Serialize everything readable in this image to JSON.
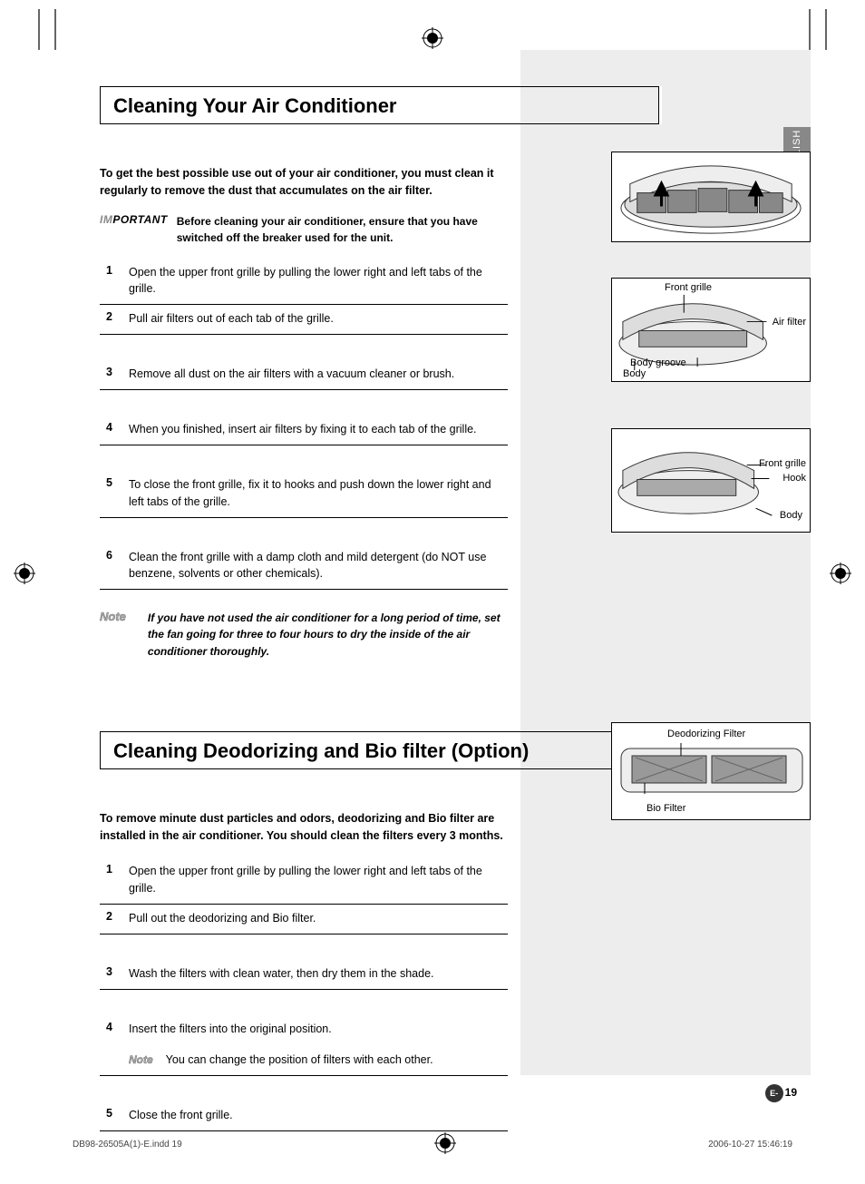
{
  "lang_tab": "ENGLISH",
  "section1": {
    "title": "Cleaning Your Air Conditioner",
    "intro": "To get the best possible use out of your air conditioner, you must clean it regularly to remove the dust that accumulates on the air filter.",
    "important_label_prefix": "IM",
    "important_label_suffix": "PORTANT",
    "important_text": "Before cleaning your air conditioner, ensure that you have switched off the breaker used for the unit.",
    "steps": [
      "Open the upper front grille by pulling the lower right and left tabs of the grille.",
      "Pull air filters out of each tab of the grille.",
      "Remove all dust on the air filters with a vacuum cleaner or brush.",
      "When you finished, insert air filters by fixing it to each tab of the grille.",
      "To close the front grille, fix it to hooks and push down the lower right and left tabs of the grille.",
      "Clean the front grille with a damp cloth and mild detergent (do NOT use benzene, solvents or other chemicals)."
    ],
    "note_label": "Note",
    "note_text": "If you have not used the air conditioner for a long period of time, set the fan going for three to four hours to dry the inside of the air conditioner thoroughly."
  },
  "section2": {
    "title": "Cleaning Deodorizing and Bio filter (Option)",
    "intro": "To remove minute dust particles and odors, deodorizing and Bio filter are installed in the air conditioner. You should clean the filters every 3 months.",
    "steps": [
      "Open the upper front grille by pulling the lower right and left tabs of the grille.",
      "Pull out the deodorizing and Bio filter.",
      "Wash the filters with clean water, then dry them in the shade.",
      "Insert the filters into the original position.",
      "Close the front grille."
    ],
    "inline_note_label": "Note",
    "inline_note_text": "You can change the position of filters with each other."
  },
  "diagram2_labels": {
    "front_grille": "Front grille",
    "air_filter": "Air filter",
    "body_groove": "Body groove",
    "body": "Body"
  },
  "diagram3_labels": {
    "front_grille": "Front grille",
    "hook": "Hook",
    "body": "Body"
  },
  "diagram4_labels": {
    "deodorizing": "Deodorizing Filter",
    "bio": "Bio Filter"
  },
  "page_num_prefix": "E-",
  "page_num": "19",
  "footer_left": "DB98-26505A(1)-E.indd   19",
  "footer_right": "2006-10-27   15:46:19"
}
